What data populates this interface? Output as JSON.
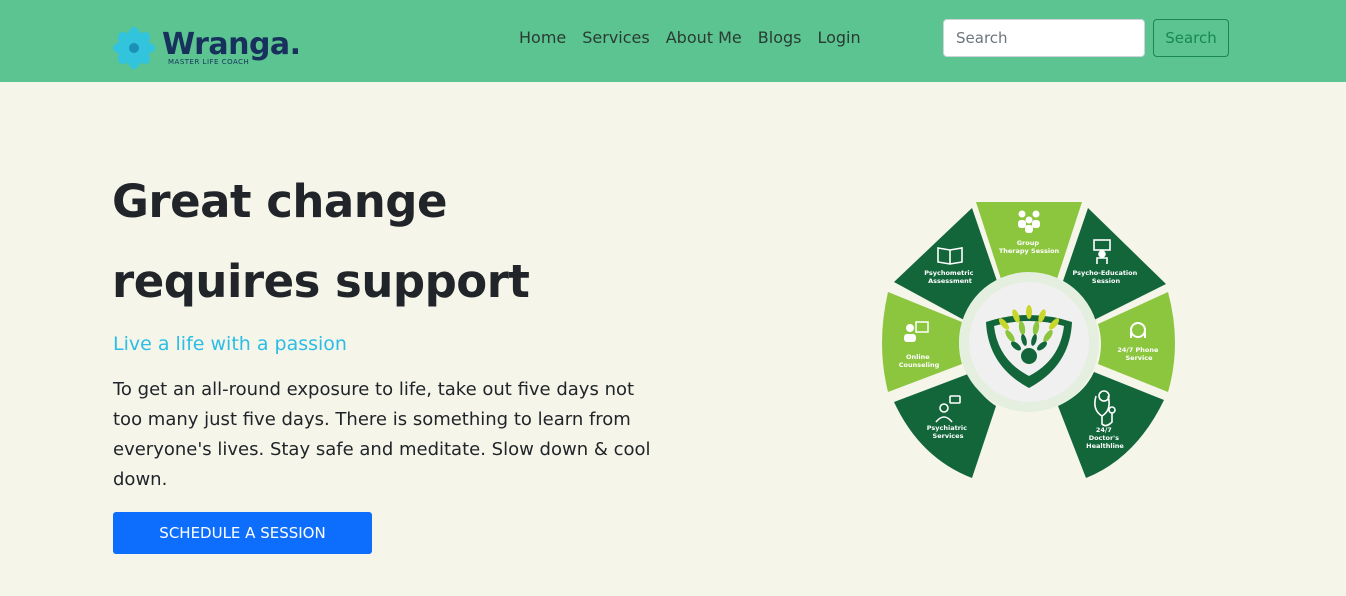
{
  "header": {
    "brand_name": "Wranga.",
    "brand_tagline": "MASTER LIFE COACH",
    "nav": [
      {
        "label": "Home"
      },
      {
        "label": "Services"
      },
      {
        "label": "About Me"
      },
      {
        "label": "Blogs"
      },
      {
        "label": "Login"
      }
    ],
    "search": {
      "placeholder": "Search",
      "value": "",
      "button_label": "Search"
    }
  },
  "hero": {
    "title_line1": "Great change",
    "title_line2": "requires support",
    "subtitle": "Live a life with a passion",
    "body": "To get an all-round exposure to life, take out five days not too many just five days. There is something to learn from everyone's lives. Stay safe and meditate. Slow down & cool down.",
    "cta_label": "SCHEDULE A SESSION"
  },
  "services_wheel": {
    "segments": [
      {
        "label_line1": "Group",
        "label_line2": "Therapy Session",
        "icon": "group-icon"
      },
      {
        "label_line1": "Psycho-Education",
        "label_line2": "Session",
        "icon": "teacher-icon"
      },
      {
        "label_line1": "24/7 Phone",
        "label_line2": "Service",
        "icon": "headset-icon"
      },
      {
        "label_line1": "24/7",
        "label_line2": "Doctor's",
        "label_line3": "Healthline",
        "icon": "stethoscope-icon"
      },
      {
        "label_line1": "Psychiatric",
        "label_line2": "Services",
        "icon": "doctor-chat-icon"
      },
      {
        "label_line1": "Online",
        "label_line2": "Counseling",
        "icon": "online-counseling-icon"
      },
      {
        "label_line1": "Psychometric",
        "label_line2": "Assessment",
        "icon": "book-icon"
      }
    ]
  },
  "colors": {
    "header_bg": "#5bc490",
    "page_bg": "#f5f5ea",
    "accent_blue": "#0d6efd",
    "subtitle_cyan": "#2bbde6",
    "wheel_dark_green": "#12663a",
    "wheel_light_green": "#8cc63f"
  }
}
